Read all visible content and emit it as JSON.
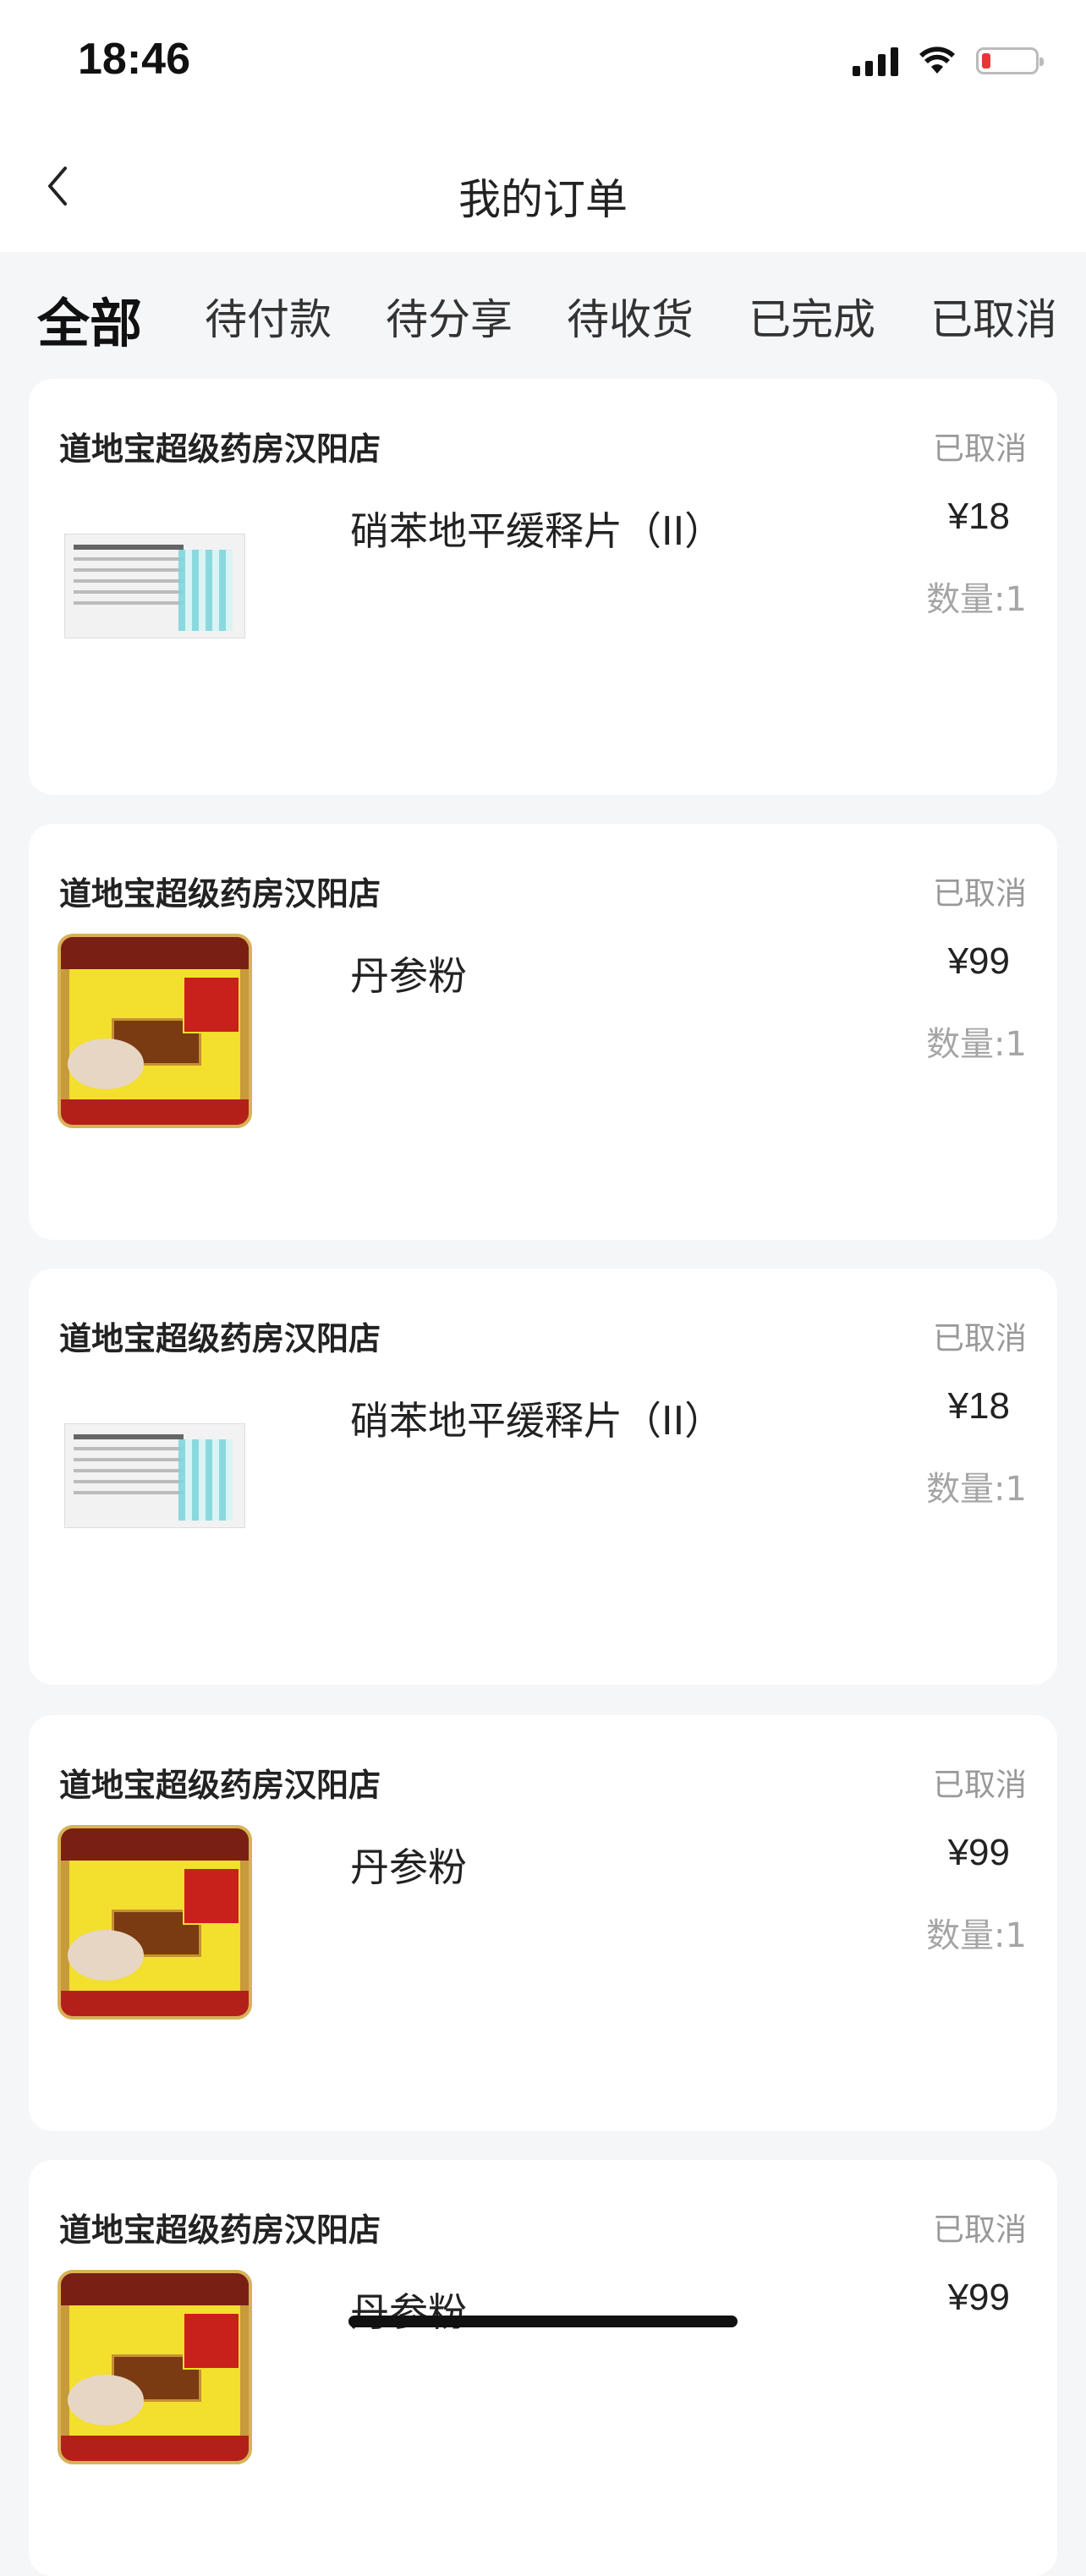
{
  "status_bar": {
    "time": "18:46"
  },
  "nav": {
    "title": "我的订单"
  },
  "tabs": [
    {
      "label": "全部",
      "active": true
    },
    {
      "label": "待付款",
      "active": false
    },
    {
      "label": "待分享",
      "active": false
    },
    {
      "label": "待收货",
      "active": false
    },
    {
      "label": "已完成",
      "active": false
    },
    {
      "label": "已取消",
      "active": false
    }
  ],
  "orders": [
    {
      "store": "道地宝超级药房汉阳店",
      "status": "已取消",
      "product": "硝苯地平缓释片（II）",
      "price": "¥18",
      "quantity": "数量:1",
      "image": "nifedipine-box"
    },
    {
      "store": "道地宝超级药房汉阳店",
      "status": "已取消",
      "product": "丹参粉",
      "price": "¥99",
      "quantity": "数量:1",
      "image": "danshen-powder-box"
    },
    {
      "store": "道地宝超级药房汉阳店",
      "status": "已取消",
      "product": "硝苯地平缓释片（II）",
      "price": "¥18",
      "quantity": "数量:1",
      "image": "nifedipine-box"
    },
    {
      "store": "道地宝超级药房汉阳店",
      "status": "已取消",
      "product": "丹参粉",
      "price": "¥99",
      "quantity": "数量:1",
      "image": "danshen-powder-box"
    },
    {
      "store": "道地宝超级药房汉阳店",
      "status": "已取消",
      "product": "丹参粉",
      "price": "¥99",
      "quantity": "",
      "image": "danshen-powder-box"
    }
  ]
}
